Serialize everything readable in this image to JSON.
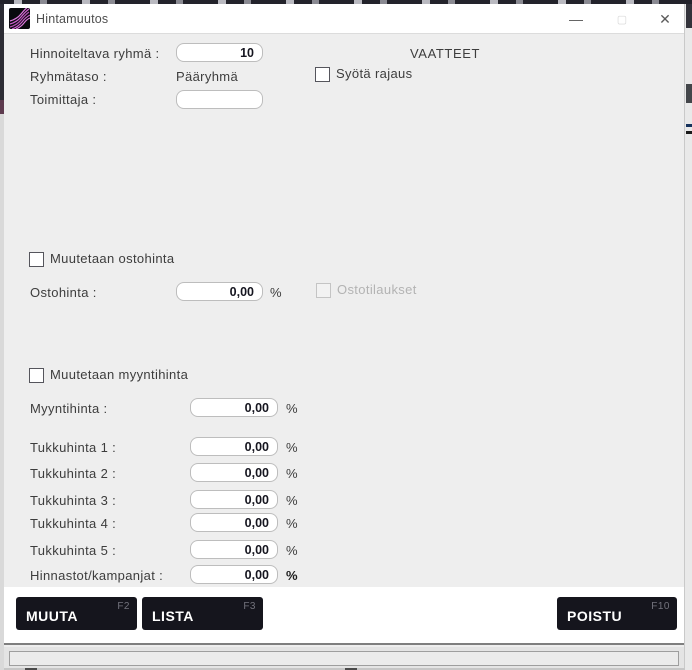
{
  "window": {
    "title": "Hintamuutos",
    "controls": {
      "minimize": "—",
      "maximize": "▢",
      "close": "✕"
    }
  },
  "form": {
    "pricing_group": {
      "label": "Hinnoiteltava ryhmä :",
      "value": "10"
    },
    "group_name": "VAATTEET",
    "group_level": {
      "label": "Ryhmätaso :",
      "value": "Pääryhmä"
    },
    "enter_filter": {
      "label": "Syötä rajaus",
      "checked": false
    },
    "supplier": {
      "label": "Toimittaja :",
      "value": ""
    },
    "purchase": {
      "toggle": {
        "label": "Muutetaan ostohinta",
        "checked": false
      },
      "price": {
        "label": "Ostohinta :",
        "value": "0,00",
        "unit": "%"
      },
      "purchase_orders": {
        "label": "Ostotilaukset",
        "checked": false,
        "disabled": true
      }
    },
    "sales": {
      "toggle": {
        "label": "Muutetaan myyntihinta",
        "checked": false
      },
      "rows": [
        {
          "label": "Myyntihinta :",
          "value": "0,00",
          "unit": "%",
          "unit_bold": false
        },
        {
          "label": "Tukkuhinta 1 :",
          "value": "0,00",
          "unit": "%",
          "unit_bold": false
        },
        {
          "label": "Tukkuhinta 2 :",
          "value": "0,00",
          "unit": "%",
          "unit_bold": false
        },
        {
          "label": "Tukkuhinta 3 :",
          "value": "0,00",
          "unit": "%",
          "unit_bold": false
        },
        {
          "label": "Tukkuhinta 4 :",
          "value": "0,00",
          "unit": "%",
          "unit_bold": false
        },
        {
          "label": "Tukkuhinta 5 :",
          "value": "0,00",
          "unit": "%",
          "unit_bold": false
        },
        {
          "label": "Hinnastot/kampanjat :",
          "value": "0,00",
          "unit": "%",
          "unit_bold": true
        }
      ]
    }
  },
  "buttons": [
    {
      "label": "MUUTA",
      "fkey": "F2"
    },
    {
      "label": "LISTA",
      "fkey": "F3"
    },
    {
      "label": "POISTU",
      "fkey": "F10"
    }
  ],
  "colors": {
    "button_bg": "#15151d",
    "icon_stripes": "#cf5fcf",
    "dialog_bg": "#eeeeee"
  }
}
